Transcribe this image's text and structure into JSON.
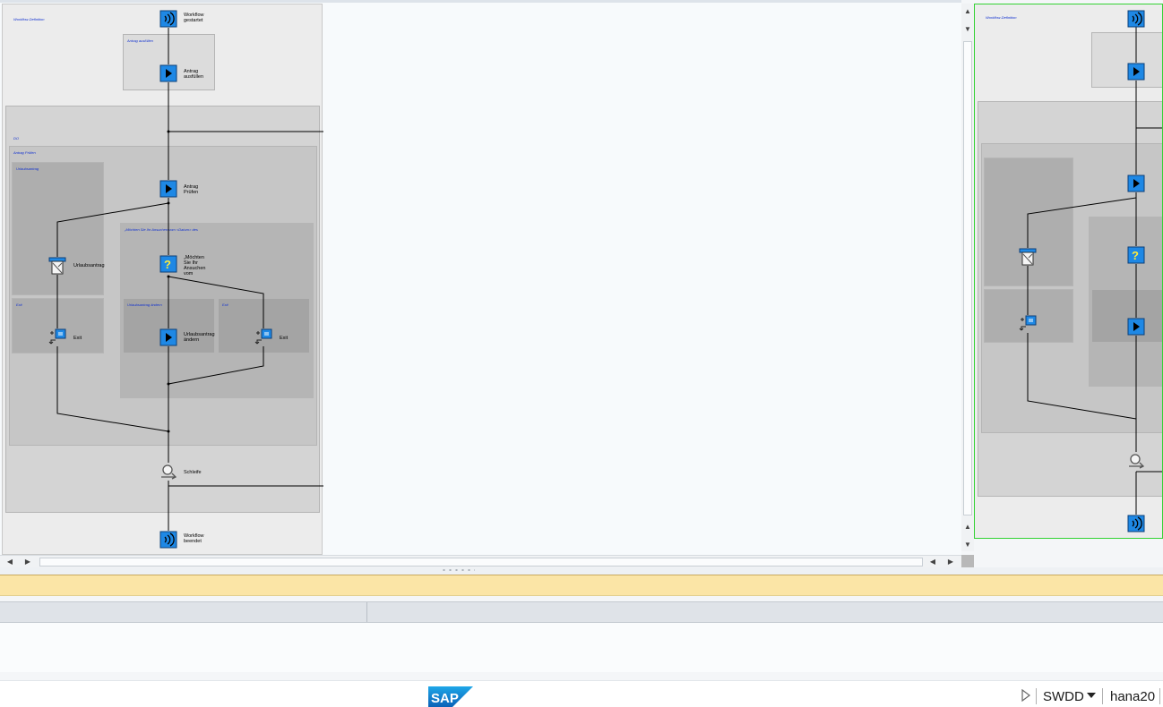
{
  "workflow": {
    "root_label": "Workflow-Definition",
    "steps": {
      "start": "Workflow\ngestartet",
      "fill": "Antrag\nausfüllen",
      "check": "Antrag\nPrüfen",
      "form": "Urlaubsantrag",
      "question": "„Möchten\nSie Ihr\nAnsuchen\nvom",
      "change": "Urlaubsantrag\nändern",
      "exit_left": "Exit",
      "exit_right": "Exit",
      "loop": "Schleife",
      "end": "Workflow\nbeendet"
    },
    "blocks": {
      "fill": "Antrag ausfüllen",
      "loop": "DO",
      "check": "Antrag Prüfen",
      "form": "Urlaubsantrag",
      "exit_left": "Exit",
      "question": "„Möchten Sie Ihr Ansuchen vom <Datum> des",
      "change": "Urlaubsantrag ändern",
      "exit_right": "Exit"
    }
  },
  "status": {
    "system": "SWDD",
    "server": "hana20",
    "logo": "SAP"
  },
  "colors": {
    "accent": "#1e88e5",
    "minimap_border": "#33d233",
    "message_bar": "#fbe5a6"
  },
  "icons": [
    "event-icon",
    "activity-icon",
    "form-icon",
    "question-icon",
    "container-op-icon",
    "loop-icon",
    "dropdown-icon"
  ]
}
